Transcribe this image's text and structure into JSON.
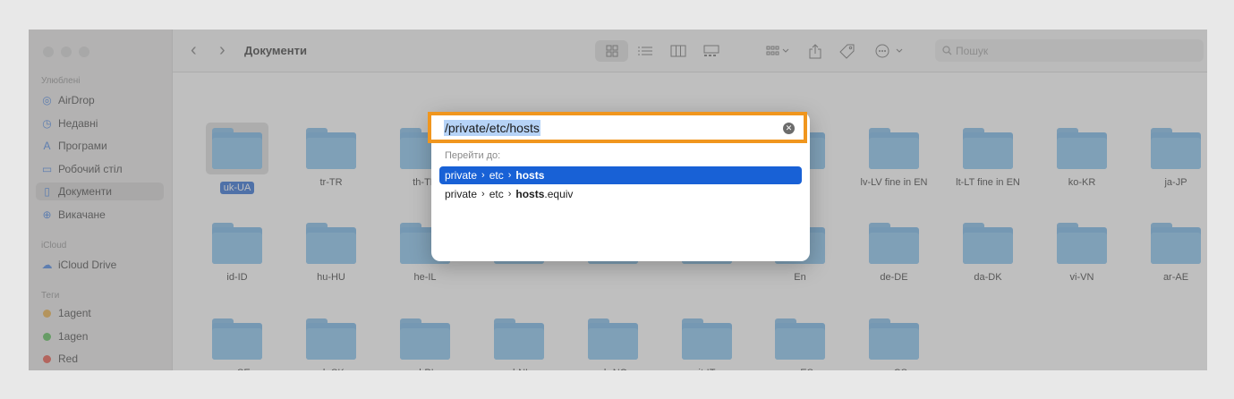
{
  "sidebar": {
    "sections": [
      {
        "title": "Улюблені"
      },
      {
        "title": "iCloud"
      },
      {
        "title": "Теги"
      }
    ],
    "favorites": [
      {
        "label": "AirDrop",
        "icon": "airdrop-icon"
      },
      {
        "label": "Недавні",
        "icon": "clock-icon"
      },
      {
        "label": "Програми",
        "icon": "apps-icon"
      },
      {
        "label": "Робочий стіл",
        "icon": "desktop-icon"
      },
      {
        "label": "Документи",
        "icon": "document-icon"
      },
      {
        "label": "Викачане",
        "icon": "download-icon"
      }
    ],
    "icloud": [
      {
        "label": "iCloud Drive",
        "icon": "cloud-icon"
      }
    ],
    "tags": [
      {
        "label": "1agent",
        "color": "#e8a93a"
      },
      {
        "label": "1agen",
        "color": "#4fb94c"
      },
      {
        "label": "Red",
        "color": "#e64b3c"
      }
    ]
  },
  "toolbar": {
    "title": "Документи",
    "search_placeholder": "Пошук",
    "back_glyph": "‹",
    "forward_glyph": "›"
  },
  "folders": [
    [
      "uk-UA",
      "tr-TR",
      "th-TH",
      "",
      "",
      "",
      "",
      "lv-LV fine in EN",
      "lt-LT fine in EN",
      "ko-KR",
      "ja-JP"
    ],
    [
      "id-ID",
      "hu-HU",
      "he-IL",
      "",
      "",
      "",
      "En",
      "de-DE",
      "da-DK",
      "vi-VN",
      "ar-AE"
    ],
    [
      "sv-SE",
      "sk-SK",
      "pl-PL",
      "nl-NL",
      "nb-NO",
      "it-IT",
      "es-ES",
      "cz-CS"
    ]
  ],
  "dialog": {
    "path_value": "/private/etc/hosts",
    "goto_label": "Перейти до:",
    "suggestions": [
      {
        "parts": [
          "private",
          "etc"
        ],
        "bold": "hosts",
        "suffix": ""
      },
      {
        "parts": [
          "private",
          "etc"
        ],
        "bold": "hosts",
        "suffix": ".equiv"
      }
    ]
  },
  "colors": {
    "highlight_border": "#f0961e",
    "selection_blue": "#1861d6",
    "folder_blue": "#7fc0ee"
  }
}
